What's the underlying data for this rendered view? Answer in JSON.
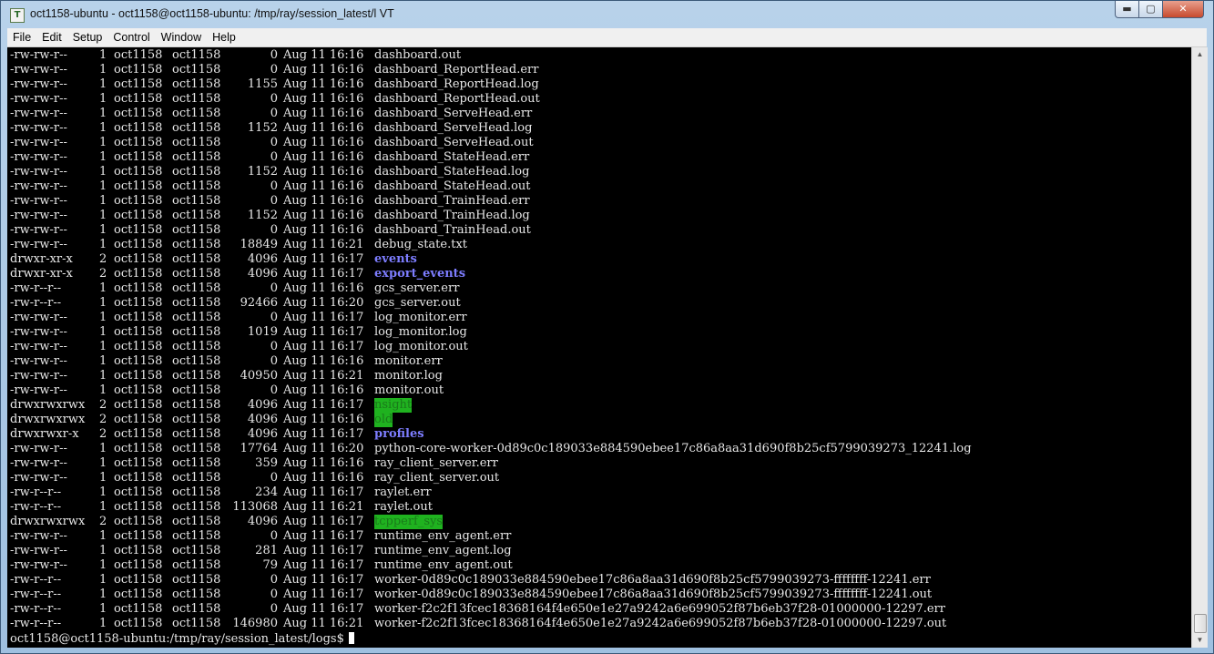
{
  "window": {
    "title": "oct1158-ubuntu - oct1158@oct1158-ubuntu: /tmp/ray/session_latest/l VT",
    "icon": "terminal-app-icon",
    "controls": {
      "minimize": "▬",
      "maximize": "▢",
      "close": "✕"
    }
  },
  "menu": [
    "File",
    "Edit",
    "Setup",
    "Control",
    "Window",
    "Help"
  ],
  "colors": {
    "dir": "#7d7dff",
    "other_writable_bg": "#1fb21f",
    "terminal_bg": "#000000",
    "text": "#e8e8e8"
  },
  "listing": [
    {
      "perm": "-rw-rw-r--",
      "links": "1",
      "user": "oct1158",
      "group": "oct1158",
      "size": "0",
      "date": "Aug 11 16:16",
      "name": "dashboard.out",
      "type": "file"
    },
    {
      "perm": "-rw-rw-r--",
      "links": "1",
      "user": "oct1158",
      "group": "oct1158",
      "size": "0",
      "date": "Aug 11 16:16",
      "name": "dashboard_ReportHead.err",
      "type": "file"
    },
    {
      "perm": "-rw-rw-r--",
      "links": "1",
      "user": "oct1158",
      "group": "oct1158",
      "size": "1155",
      "date": "Aug 11 16:16",
      "name": "dashboard_ReportHead.log",
      "type": "file"
    },
    {
      "perm": "-rw-rw-r--",
      "links": "1",
      "user": "oct1158",
      "group": "oct1158",
      "size": "0",
      "date": "Aug 11 16:16",
      "name": "dashboard_ReportHead.out",
      "type": "file"
    },
    {
      "perm": "-rw-rw-r--",
      "links": "1",
      "user": "oct1158",
      "group": "oct1158",
      "size": "0",
      "date": "Aug 11 16:16",
      "name": "dashboard_ServeHead.err",
      "type": "file"
    },
    {
      "perm": "-rw-rw-r--",
      "links": "1",
      "user": "oct1158",
      "group": "oct1158",
      "size": "1152",
      "date": "Aug 11 16:16",
      "name": "dashboard_ServeHead.log",
      "type": "file"
    },
    {
      "perm": "-rw-rw-r--",
      "links": "1",
      "user": "oct1158",
      "group": "oct1158",
      "size": "0",
      "date": "Aug 11 16:16",
      "name": "dashboard_ServeHead.out",
      "type": "file"
    },
    {
      "perm": "-rw-rw-r--",
      "links": "1",
      "user": "oct1158",
      "group": "oct1158",
      "size": "0",
      "date": "Aug 11 16:16",
      "name": "dashboard_StateHead.err",
      "type": "file"
    },
    {
      "perm": "-rw-rw-r--",
      "links": "1",
      "user": "oct1158",
      "group": "oct1158",
      "size": "1152",
      "date": "Aug 11 16:16",
      "name": "dashboard_StateHead.log",
      "type": "file"
    },
    {
      "perm": "-rw-rw-r--",
      "links": "1",
      "user": "oct1158",
      "group": "oct1158",
      "size": "0",
      "date": "Aug 11 16:16",
      "name": "dashboard_StateHead.out",
      "type": "file"
    },
    {
      "perm": "-rw-rw-r--",
      "links": "1",
      "user": "oct1158",
      "group": "oct1158",
      "size": "0",
      "date": "Aug 11 16:16",
      "name": "dashboard_TrainHead.err",
      "type": "file"
    },
    {
      "perm": "-rw-rw-r--",
      "links": "1",
      "user": "oct1158",
      "group": "oct1158",
      "size": "1152",
      "date": "Aug 11 16:16",
      "name": "dashboard_TrainHead.log",
      "type": "file"
    },
    {
      "perm": "-rw-rw-r--",
      "links": "1",
      "user": "oct1158",
      "group": "oct1158",
      "size": "0",
      "date": "Aug 11 16:16",
      "name": "dashboard_TrainHead.out",
      "type": "file"
    },
    {
      "perm": "-rw-rw-r--",
      "links": "1",
      "user": "oct1158",
      "group": "oct1158",
      "size": "18849",
      "date": "Aug 11 16:21",
      "name": "debug_state.txt",
      "type": "file"
    },
    {
      "perm": "drwxr-xr-x",
      "links": "2",
      "user": "oct1158",
      "group": "oct1158",
      "size": "4096",
      "date": "Aug 11 16:17",
      "name": "events",
      "type": "dir"
    },
    {
      "perm": "drwxr-xr-x",
      "links": "2",
      "user": "oct1158",
      "group": "oct1158",
      "size": "4096",
      "date": "Aug 11 16:17",
      "name": "export_events",
      "type": "dir"
    },
    {
      "perm": "-rw-r--r--",
      "links": "1",
      "user": "oct1158",
      "group": "oct1158",
      "size": "0",
      "date": "Aug 11 16:16",
      "name": "gcs_server.err",
      "type": "file"
    },
    {
      "perm": "-rw-r--r--",
      "links": "1",
      "user": "oct1158",
      "group": "oct1158",
      "size": "92466",
      "date": "Aug 11 16:20",
      "name": "gcs_server.out",
      "type": "file"
    },
    {
      "perm": "-rw-rw-r--",
      "links": "1",
      "user": "oct1158",
      "group": "oct1158",
      "size": "0",
      "date": "Aug 11 16:17",
      "name": "log_monitor.err",
      "type": "file"
    },
    {
      "perm": "-rw-rw-r--",
      "links": "1",
      "user": "oct1158",
      "group": "oct1158",
      "size": "1019",
      "date": "Aug 11 16:17",
      "name": "log_monitor.log",
      "type": "file"
    },
    {
      "perm": "-rw-rw-r--",
      "links": "1",
      "user": "oct1158",
      "group": "oct1158",
      "size": "0",
      "date": "Aug 11 16:17",
      "name": "log_monitor.out",
      "type": "file"
    },
    {
      "perm": "-rw-rw-r--",
      "links": "1",
      "user": "oct1158",
      "group": "oct1158",
      "size": "0",
      "date": "Aug 11 16:16",
      "name": "monitor.err",
      "type": "file"
    },
    {
      "perm": "-rw-rw-r--",
      "links": "1",
      "user": "oct1158",
      "group": "oct1158",
      "size": "40950",
      "date": "Aug 11 16:21",
      "name": "monitor.log",
      "type": "file"
    },
    {
      "perm": "-rw-rw-r--",
      "links": "1",
      "user": "oct1158",
      "group": "oct1158",
      "size": "0",
      "date": "Aug 11 16:16",
      "name": "monitor.out",
      "type": "file"
    },
    {
      "perm": "drwxrwxrwx",
      "links": "2",
      "user": "oct1158",
      "group": "oct1158",
      "size": "4096",
      "date": "Aug 11 16:17",
      "name": "nsight",
      "type": "ow"
    },
    {
      "perm": "drwxrwxrwx",
      "links": "2",
      "user": "oct1158",
      "group": "oct1158",
      "size": "4096",
      "date": "Aug 11 16:16",
      "name": "old",
      "type": "ow"
    },
    {
      "perm": "drwxrwxr-x",
      "links": "2",
      "user": "oct1158",
      "group": "oct1158",
      "size": "4096",
      "date": "Aug 11 16:17",
      "name": "profiles",
      "type": "dir"
    },
    {
      "perm": "-rw-rw-r--",
      "links": "1",
      "user": "oct1158",
      "group": "oct1158",
      "size": "17764",
      "date": "Aug 11 16:20",
      "name": "python-core-worker-0d89c0c189033e884590ebee17c86a8aa31d690f8b25cf5799039273_12241.log",
      "type": "file"
    },
    {
      "perm": "-rw-rw-r--",
      "links": "1",
      "user": "oct1158",
      "group": "oct1158",
      "size": "359",
      "date": "Aug 11 16:16",
      "name": "ray_client_server.err",
      "type": "file"
    },
    {
      "perm": "-rw-rw-r--",
      "links": "1",
      "user": "oct1158",
      "group": "oct1158",
      "size": "0",
      "date": "Aug 11 16:16",
      "name": "ray_client_server.out",
      "type": "file"
    },
    {
      "perm": "-rw-r--r--",
      "links": "1",
      "user": "oct1158",
      "group": "oct1158",
      "size": "234",
      "date": "Aug 11 16:17",
      "name": "raylet.err",
      "type": "file"
    },
    {
      "perm": "-rw-r--r--",
      "links": "1",
      "user": "oct1158",
      "group": "oct1158",
      "size": "113068",
      "date": "Aug 11 16:21",
      "name": "raylet.out",
      "type": "file"
    },
    {
      "perm": "drwxrwxrwx",
      "links": "2",
      "user": "oct1158",
      "group": "oct1158",
      "size": "4096",
      "date": "Aug 11 16:17",
      "name": "tcpperf_sys",
      "type": "ow"
    },
    {
      "perm": "-rw-rw-r--",
      "links": "1",
      "user": "oct1158",
      "group": "oct1158",
      "size": "0",
      "date": "Aug 11 16:17",
      "name": "runtime_env_agent.err",
      "type": "file"
    },
    {
      "perm": "-rw-rw-r--",
      "links": "1",
      "user": "oct1158",
      "group": "oct1158",
      "size": "281",
      "date": "Aug 11 16:17",
      "name": "runtime_env_agent.log",
      "type": "file"
    },
    {
      "perm": "-rw-rw-r--",
      "links": "1",
      "user": "oct1158",
      "group": "oct1158",
      "size": "79",
      "date": "Aug 11 16:17",
      "name": "runtime_env_agent.out",
      "type": "file"
    },
    {
      "perm": "-rw-r--r--",
      "links": "1",
      "user": "oct1158",
      "group": "oct1158",
      "size": "0",
      "date": "Aug 11 16:17",
      "name": "worker-0d89c0c189033e884590ebee17c86a8aa31d690f8b25cf5799039273-ffffffff-12241.err",
      "type": "file"
    },
    {
      "perm": "-rw-r--r--",
      "links": "1",
      "user": "oct1158",
      "group": "oct1158",
      "size": "0",
      "date": "Aug 11 16:17",
      "name": "worker-0d89c0c189033e884590ebee17c86a8aa31d690f8b25cf5799039273-ffffffff-12241.out",
      "type": "file"
    },
    {
      "perm": "-rw-r--r--",
      "links": "1",
      "user": "oct1158",
      "group": "oct1158",
      "size": "0",
      "date": "Aug 11 16:17",
      "name": "worker-f2c2f13fcec18368164f4e650e1e27a9242a6e699052f87b6eb37f28-01000000-12297.err",
      "type": "file"
    },
    {
      "perm": "-rw-r--r--",
      "links": "1",
      "user": "oct1158",
      "group": "oct1158",
      "size": "146980",
      "date": "Aug 11 16:21",
      "name": "worker-f2c2f13fcec18368164f4e650e1e27a9242a6e699052f87b6eb37f28-01000000-12297.out",
      "type": "file"
    }
  ],
  "prompt": "oct1158@oct1158-ubuntu:/tmp/ray/session_latest/logs$",
  "scrollbar": {
    "up": "▲",
    "down": "▼",
    "position": 0.97
  }
}
